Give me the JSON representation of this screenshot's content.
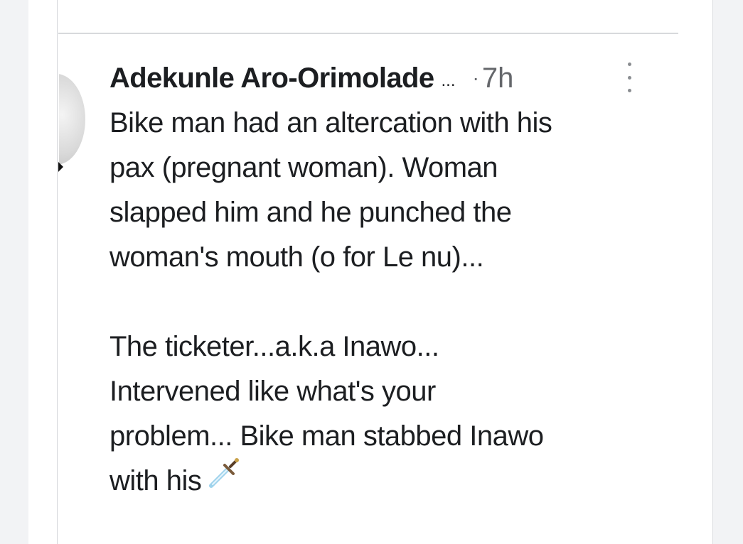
{
  "comment": {
    "author": "Adekunle Aro-Orimolade",
    "truncation": "...",
    "separator": "·",
    "timestamp": "7h",
    "body_lines": [
      "Bike man had an altercation with his",
      "pax (pregnant woman). Woman",
      "slapped him and he punched the",
      "woman's mouth (o for Le nu)...",
      "The ticketer...a.k.a Inawo...",
      "Intervened like what's your",
      "problem... Bike man stabbed Inawo",
      "with his"
    ],
    "trailing_emoji": "dagger-icon"
  },
  "colors": {
    "text": "#1c1e21",
    "secondary": "#65676b",
    "divider": "#d7d9dc",
    "background": "#f2f3f5"
  }
}
